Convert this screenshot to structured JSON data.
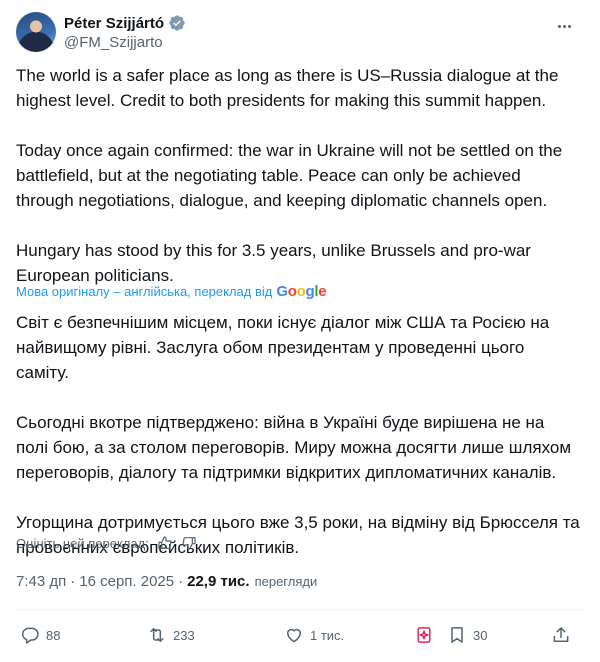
{
  "author": {
    "display_name": "Péter Szijjártó",
    "handle": "@FM_Szijjarto"
  },
  "tweet": {
    "paragraphs": [
      "The world is a safer place as long as there is US–Russia dialogue at the highest level. Credit to both presidents for making this summit happen.",
      "Today once again confirmed: the war in Ukraine will not be settled on the battlefield, but at the negotiating table. Peace can only be achieved through negotiations, dialogue, and keeping diplomatic channels open.",
      "Hungary has stood by this for 3.5 years, unlike Brussels and pro-war European politicians."
    ]
  },
  "translation": {
    "note": "Мова оригіналу – англійська, переклад від",
    "provider": "Google",
    "paragraphs": [
      "Світ є безпечнішим місцем, поки існує діалог між США та Росією на найвищому рівні. Заслуга обом президентам у проведенні цього саміту.",
      "Сьогодні вкотре підтверджено: війна в Україні буде вирішена не на полі бою, а за столом переговорів. Миру можна досягти лише шляхом переговорів, діалогу та підтримки відкритих дипломатичних каналів.",
      "Угорщина дотримується цього вже 3,5 роки, на відміну від Брюсселя та провоєнних європейських політиків."
    ],
    "rate_label": "Оцініть цей переклад:"
  },
  "meta": {
    "time": "7:43 дп",
    "separator": "·",
    "date": "16 серп. 2025",
    "views_count": "22,9 тис.",
    "views_label": "перегляди"
  },
  "actions": {
    "replies": "88",
    "reposts": "233",
    "likes": "1 тис.",
    "bookmarks": "30"
  },
  "colors": {
    "accent": "#1d9bf0",
    "text": "#0f1419",
    "muted": "#536471",
    "grok_icon": "#e0245e"
  },
  "icons": [
    "verified-badge-icon",
    "more-icon",
    "thumbs-up-icon",
    "thumbs-down-icon",
    "reply-icon",
    "repost-icon",
    "like-icon",
    "grok-icon",
    "bookmark-icon",
    "share-icon"
  ]
}
